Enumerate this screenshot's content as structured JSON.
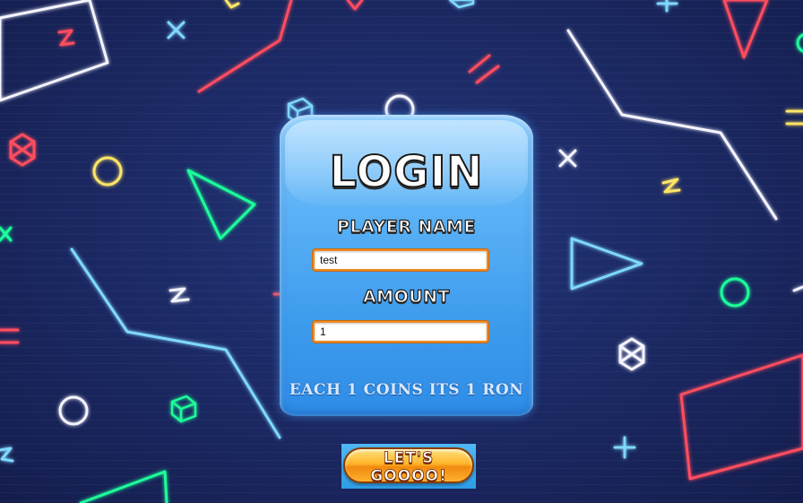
{
  "login": {
    "title": "LOGIN",
    "player_name_label": "PLAYER NAME",
    "player_name_value": "test",
    "amount_label": "AMOUNT",
    "amount_value": "1",
    "info_text": "EACH 1 COINS ITS 1 RON",
    "submit_label": "LET'S GOOOO!"
  },
  "colors": {
    "background": "#1c2a66",
    "panel": "#3d9bed",
    "input_border": "#f08b22",
    "button": "#ffb52a",
    "neon_red": "#ff4d5e",
    "neon_blue": "#7fd8ff",
    "neon_green": "#1fff9a",
    "neon_yellow": "#ffe566",
    "neon_white": "#f4f4ff"
  },
  "background_icons": [
    "triangle-icon",
    "circle-icon",
    "cross-icon",
    "cube-icon",
    "zigzag-icon",
    "line-icon",
    "hexagon-icon"
  ]
}
